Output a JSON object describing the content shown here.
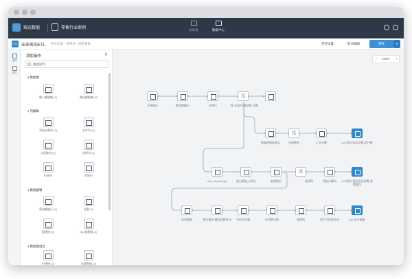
{
  "topnav": {
    "brand": "观远数据",
    "project": "零售行业案例",
    "items": [
      {
        "label": "仪表板",
        "icon": "dashboard-icon"
      },
      {
        "label": "数据中心",
        "icon": "data-center-icon"
      }
    ]
  },
  "toolbar": {
    "badge": "ETL",
    "doc_name": "未命名的ETL",
    "breadcrumb": "所在位置：根目录 › 销售看板",
    "update_settings": "更新设置",
    "cancel_edit": "取消编辑",
    "save": "保存",
    "save_more": "▾"
  },
  "rail": [
    {
      "label": "添加",
      "icon": "add-icon",
      "active": true
    },
    {
      "label": "属性",
      "icon": "properties-icon",
      "active": false
    }
  ],
  "panel": {
    "title": "添加操作",
    "close": "✕",
    "search_placeholder": "搜索操作",
    "sections": [
      {
        "title": "数据集",
        "ops": [
          "输入数据集 (2)",
          "输出数据集 (2)"
        ]
      },
      {
        "title": "列编辑",
        "ops": [
          "添加计算列 (2)",
          "合并列 (2)",
          "分组聚合 (2)",
          "选择列 (2)",
          "行转列",
          "列转行"
        ]
      },
      {
        "title": "数据编辑",
        "ops": [
          "筛选数据行 (2)",
          "去重 (2)",
          "值替换 (2)",
          "Null值替换 (2)"
        ]
      },
      {
        "title": "数据集组合",
        "ops": [
          "行拼接 (2)",
          "关联数据 (2)"
        ]
      }
    ]
  },
  "zoom": {
    "minus": "−",
    "value": "100%",
    "plus": "+"
  },
  "flow": {
    "row1": [
      "订单统计",
      "筛选数据行",
      "列转行",
      "",
      "按-关系列-截至数-次数"
    ],
    "row2": [
      "",
      "数据转换标准化",
      "分组聚合",
      "汇总计算",
      "UA-判别-购买次数-用户数"
    ],
    "row3": [
      "unix_timestamp",
      "各日期加入时间",
      "各类数目",
      "",
      "选择列",
      "添加计算列",
      "UA-判别-是否会员续费-消费频次"
    ],
    "row4": [
      "合并数据",
      "累计频次-最近续费时间",
      "手机号去重",
      "未消费天数",
      "选择列",
      "用户活跃度评分",
      "UA-用户画像"
    ]
  }
}
